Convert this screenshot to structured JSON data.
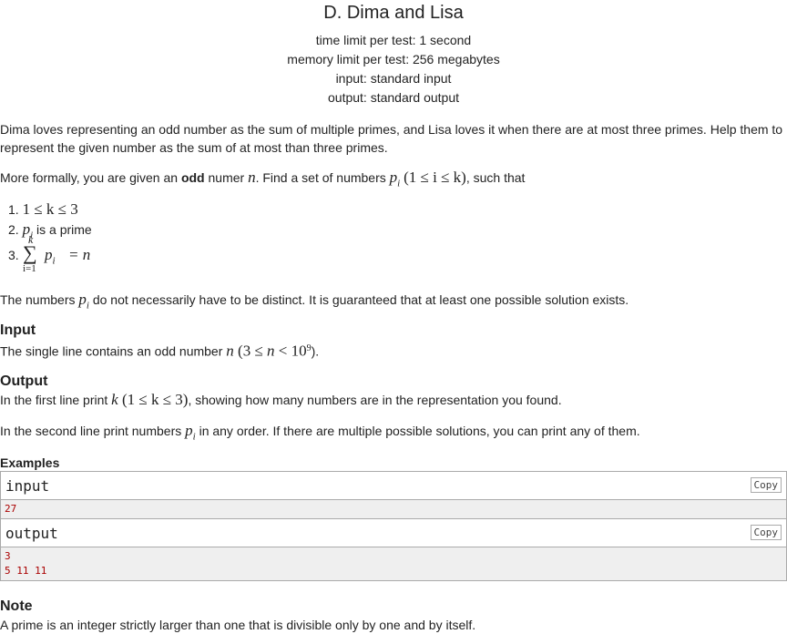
{
  "title": "D. Dima and Lisa",
  "meta": {
    "time_limit": "time limit per test: 1 second",
    "memory_limit": "memory limit per test: 256 megabytes",
    "input": "input: standard input",
    "output": "output: standard output"
  },
  "statement": {
    "p1": "Dima loves representing an odd number as the sum of multiple primes, and Lisa loves it when there are at most three primes. Help them to represent the given number as the sum of at most than three primes.",
    "p2_a": "More formally, you are given an ",
    "p2_bold": "odd",
    "p2_b": " numer ",
    "p2_n": "n",
    "p2_c": ". Find a set of numbers ",
    "p2_math": "(1 ≤ i ≤ k)",
    "p2_d": ", such that",
    "cond1_num": "1.",
    "cond1_math": "1 ≤ k ≤ 3",
    "cond2_num": "2.",
    "cond2_text": " is a prime",
    "cond3_num": "3.",
    "cond3_sup": "k",
    "cond3_sub": "i=1",
    "cond3_eq": "= n",
    "p3_a": "The numbers ",
    "p3_b": " do not necessarily have to be distinct. It is guaranteed that at least one possible solution exists."
  },
  "input_section": {
    "heading": "Input",
    "text_a": "The single line contains an odd number ",
    "text_n": "n",
    "text_math_a": " (3 ≤ ",
    "text_math_n": "n",
    "text_math_b": " < 10",
    "text_sup": "9",
    "text_b": ")."
  },
  "output_section": {
    "heading": "Output",
    "line1_a": "In the first line print ",
    "line1_k": "k",
    "line1_math": " (1 ≤ k ≤ 3)",
    "line1_b": ", showing how many numbers are in the representation you found.",
    "line2_a": "In the second line print numbers ",
    "line2_b": " in any order. If there are multiple possible solutions, you can print any of them."
  },
  "examples": {
    "heading": "Examples",
    "input_label": "input",
    "output_label": "output",
    "copy_label": "Copy",
    "input_value": "27",
    "output_value": "3\n5 11 11"
  },
  "note": {
    "heading": "Note",
    "text": "A prime is an integer strictly larger than one that is divisible only by one and by itself."
  }
}
